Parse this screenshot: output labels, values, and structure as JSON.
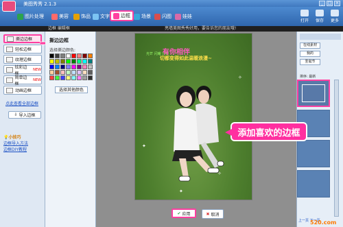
{
  "app": {
    "title": "美图秀秀 2.1.3"
  },
  "tabs": [
    {
      "label": "图片处理",
      "color": "#2ca34c"
    },
    {
      "label": "美容",
      "color": "#ff6a6a"
    },
    {
      "label": "饰品",
      "color": "#e6a100"
    },
    {
      "label": "文字",
      "color": "#7bc3f3"
    },
    {
      "label": "边框",
      "color": "#ff3fa0"
    },
    {
      "label": "场景",
      "color": "#3aa7d9"
    },
    {
      "label": "闪图",
      "color": "#d94d4d"
    },
    {
      "label": "娃娃",
      "color": "#d96aa8"
    }
  ],
  "right_tools": [
    "打开",
    "保存",
    "更多"
  ],
  "breadcrumb": "边框 编辑框",
  "tip": "亮墙美图秀秀好用，要告诉您的朋友哦!",
  "left_menu": [
    {
      "label": "撕边边框",
      "new": false
    },
    {
      "label": "轻松边框",
      "new": false
    },
    {
      "label": "纹理边框",
      "new": false
    },
    {
      "label": "炫彩边框",
      "new": true
    },
    {
      "label": "简单边框",
      "new": true
    },
    {
      "label": "动画边框",
      "new": false
    }
  ],
  "new_badge": "NEW",
  "left_link": "点此查看全部边框",
  "import_label": "导入边框",
  "tips": {
    "title": "小技巧",
    "line1": "边框导入方法",
    "line2": "边框DIY教程"
  },
  "color_panel": {
    "title": "撕边边框",
    "subtitle": "选择撕边颜色:",
    "other_button": "选择其他颜色",
    "swatches": [
      "#000000",
      "#404040",
      "#7f7f7f",
      "#ffffff",
      "#ff0000",
      "#ff8080",
      "#800000",
      "#ff8000",
      "#ffff00",
      "#c0c000",
      "#808000",
      "#00ff00",
      "#008000",
      "#00ff80",
      "#00ffff",
      "#008080",
      "#0000ff",
      "#0080ff",
      "#000080",
      "#8080ff",
      "#ff00ff",
      "#800080",
      "#ff80c0",
      "#c0c0c0",
      "#ffd0a0",
      "#a0522d",
      "#ffc0c0",
      "#c0ffc0",
      "#c0e0ff",
      "#e0c0ff",
      "#ffe0c0",
      "#606060",
      "#ff4040",
      "#40ff40",
      "#4040ff",
      "#ffff80",
      "#80ffff",
      "#ff80ff",
      "#a0a0a0",
      "#303030"
    ]
  },
  "photo_text": {
    "line0": "光芒 闪耀 只有",
    "line1": "有你相伴",
    "line2": "切都变得如此温暖浪漫~"
  },
  "apply_label": "应用",
  "cancel_label": "取消",
  "callout": "添加喜欢的边框",
  "right_panel": {
    "online": "在线素材",
    "my": "我的",
    "cat": "圣诞节",
    "sort": "排序: 最新",
    "pager": "上一页 下一页"
  },
  "watermark": "520.com"
}
